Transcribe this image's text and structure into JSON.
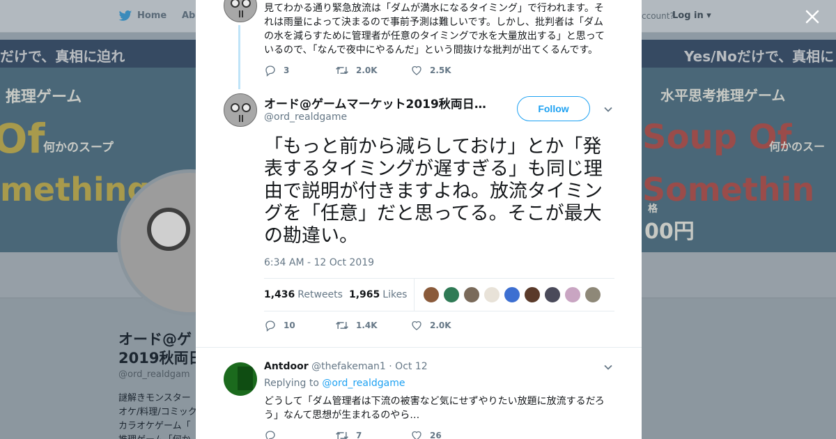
{
  "background": {
    "nav": {
      "home": "Home",
      "about": "Abo",
      "account_prompt": "ccount?",
      "login": "Log in"
    },
    "banner": {
      "left_top": "だけで、真相に迫れ",
      "left_genre": "推理ゲーム",
      "left_big1": "Of",
      "left_sub": "何かのスープ",
      "left_big2": "mething",
      "right_top": "Yes/Noだけで、真相に",
      "right_genre": "水平思考推理ゲーム",
      "right_big1": "Soup Of",
      "right_sub": "何かのスー",
      "right_big2": "Somethin",
      "price_label": "格",
      "price": "00円"
    },
    "profile": {
      "name_line1": "オード@ゲ",
      "name_line2": "2019秋両日",
      "handle": "@ord_realdgam",
      "bio_lines": [
        "謎解きモンスター",
        "オケ/料理/コミック",
        "カラオケゲーム「",
        "推理ゲーム「何か"
      ]
    }
  },
  "previous_tweet": {
    "text": "見てわかる通り緊急放流は「ダムが満水になるタイミング」で行われます。それは雨量によって決まるので事前予測は難しいです。しかし、批判者は「ダムの水を減らすために管理者が任意のタイミングで水を大量放出する」と思っているので、「なんで夜中にやるんだ」という間抜けな批判が出てくるんです。",
    "replies": "3",
    "retweets": "2.0K",
    "likes": "2.5K"
  },
  "main_tweet": {
    "author_name": "オード@ゲームマーケット2019秋両日...",
    "author_handle": "@ord_realdgame",
    "follow_label": "Follow",
    "text": "「もっと前から減らしておけ」とか「発表するタイミングが遅すぎる」も同じ理由で説明が付きますよね。放流タイミングを「任意」だと思ってる。そこが最大の勘違い。",
    "timestamp": "6:34 AM - 12 Oct 2019",
    "retweet_count": "1,436",
    "retweet_label": "Retweets",
    "like_count": "1,965",
    "like_label": "Likes",
    "replies": "10",
    "retweets": "1.4K",
    "likes": "2.0K",
    "liker_colors": [
      "#8a5a3a",
      "#2f7a55",
      "#7a6a5a",
      "#e8e2d8",
      "#3d6fd1",
      "#5a3a2a",
      "#4a4a5a",
      "#c9a5c2",
      "#8e8878"
    ]
  },
  "reply_tweet": {
    "author_name": "Antdoor",
    "author_handle": "@thefakeman1",
    "date": "Oct 12",
    "replying_prefix": "Replying to",
    "replying_to": "@ord_realdgame",
    "text": "どうして「ダム管理者は下流の被害など気にせずやりたい放題に放流するだろう」なんて思想が生まれるのやら…",
    "replies": "",
    "retweets": "7",
    "likes": "26"
  },
  "colors": {
    "accent": "#1da1f2",
    "text_primary": "#14171a",
    "text_secondary": "#657786"
  }
}
